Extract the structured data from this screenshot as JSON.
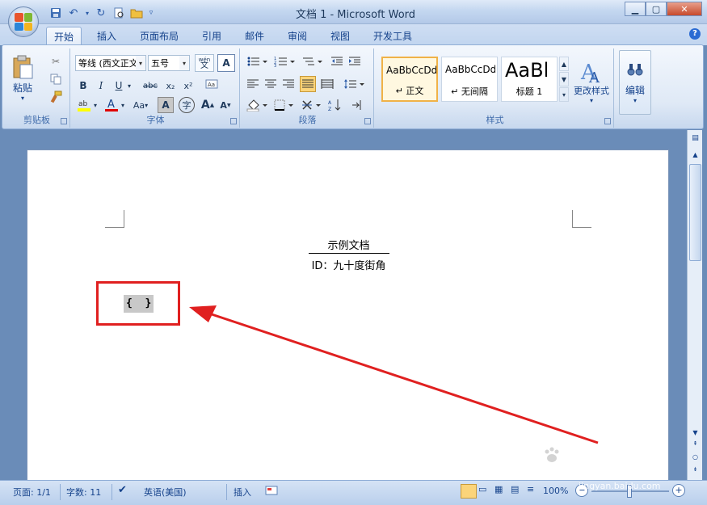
{
  "window": {
    "title": "文档 1 - Microsoft Word"
  },
  "tabs": [
    "开始",
    "插入",
    "页面布局",
    "引用",
    "邮件",
    "审阅",
    "视图",
    "开发工具"
  ],
  "ribbon": {
    "clipboard": {
      "paste": "粘贴",
      "label": "剪贴板"
    },
    "font": {
      "font_name": "等线 (西文正文",
      "font_size": "五号",
      "label": "字体",
      "phonetic": "wén",
      "format_glyphs": [
        "B",
        "I",
        "U",
        "abc",
        "x₂",
        "x²"
      ],
      "case_label": "Aa"
    },
    "paragraph": {
      "label": "段落"
    },
    "styles": {
      "label": "样式",
      "items": [
        {
          "preview": "AaBbCcDd",
          "name": "↵ 正文"
        },
        {
          "preview": "AaBbCcDd",
          "name": "↵ 无间隔"
        },
        {
          "preview": "AaBl",
          "name": "标题 1"
        }
      ],
      "change_styles": "更改样式"
    },
    "editing": {
      "label": "编辑"
    }
  },
  "document": {
    "title": "示例文档",
    "id_line": "ID：九十度街角",
    "field_code": "{  }"
  },
  "status": {
    "page": "页面: 1/1",
    "words": "字数: 11",
    "language": "英语(美国)",
    "insert_mode": "插入",
    "zoom": "100%"
  },
  "watermark": {
    "brand": "Baidu经验",
    "url": "jingyan.baidu.com"
  },
  "colors": {
    "annotation_red": "#e02020",
    "highlight_yellow": "#ffff00",
    "font_red": "#e00000"
  }
}
